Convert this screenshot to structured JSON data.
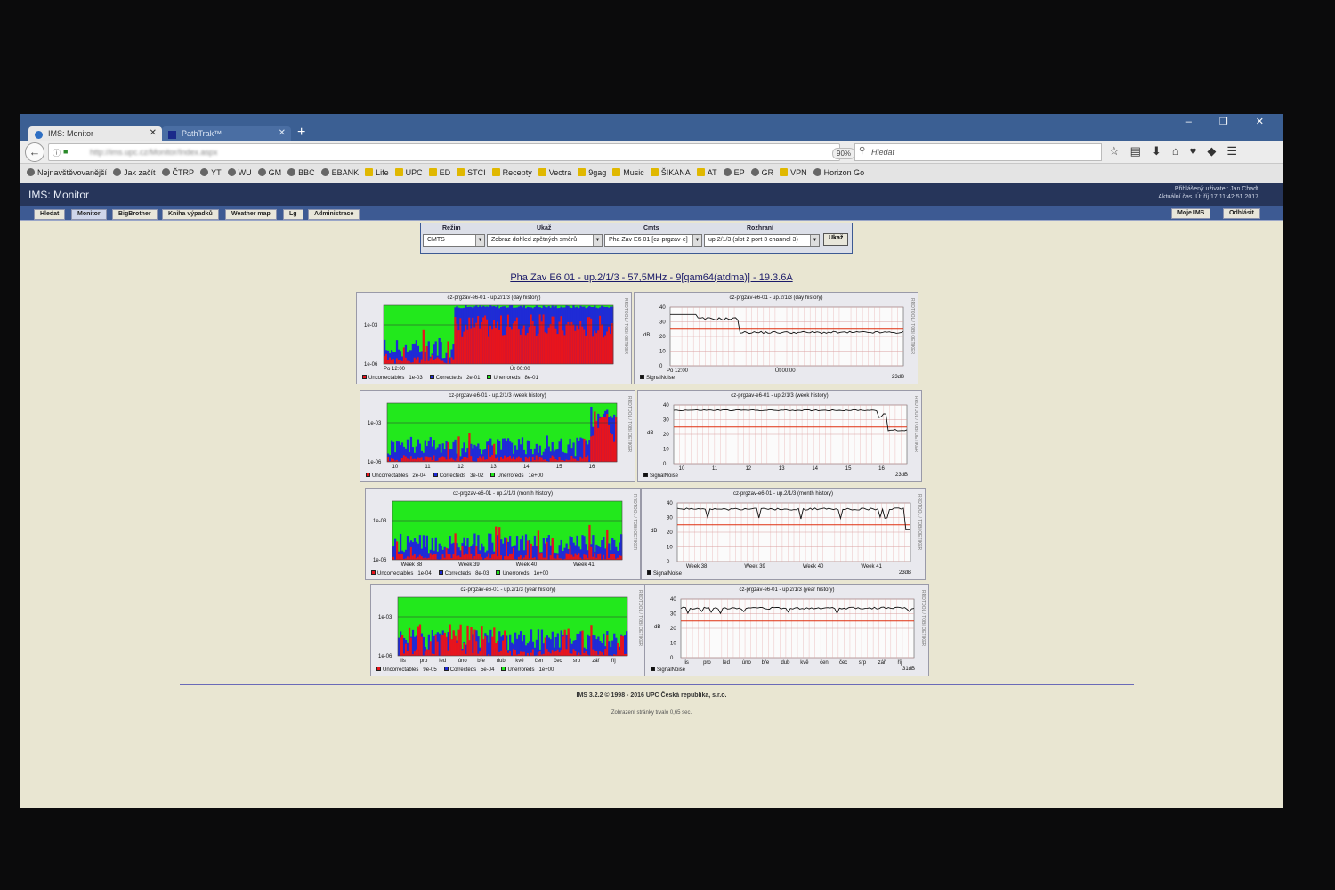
{
  "browser": {
    "tabs": [
      {
        "label": "IMS: Monitor",
        "active": true
      },
      {
        "label": "PathTrak™",
        "active": false
      }
    ],
    "url": "http://ims.upc.cz/Monitor/Index.aspx",
    "zoom": "90%",
    "search_placeholder": "Hledat",
    "bookmarks": [
      {
        "label": "Nejnavštěvovanější",
        "icon": "web"
      },
      {
        "label": "Jak začít",
        "icon": "web"
      },
      {
        "label": "ČTRP",
        "icon": "web"
      },
      {
        "label": "YT",
        "icon": "web"
      },
      {
        "label": "WU",
        "icon": "web"
      },
      {
        "label": "GM",
        "icon": "web"
      },
      {
        "label": "BBC",
        "icon": "web"
      },
      {
        "label": "EBANK",
        "icon": "web"
      },
      {
        "label": "Life",
        "icon": "folder"
      },
      {
        "label": "UPC",
        "icon": "folder"
      },
      {
        "label": "ED",
        "icon": "folder"
      },
      {
        "label": "STCI",
        "icon": "folder"
      },
      {
        "label": "Recepty",
        "icon": "folder"
      },
      {
        "label": "Vectra",
        "icon": "folder"
      },
      {
        "label": "9gag",
        "icon": "folder"
      },
      {
        "label": "Music",
        "icon": "folder"
      },
      {
        "label": "ŠIKANA",
        "icon": "folder"
      },
      {
        "label": "AT",
        "icon": "folder"
      },
      {
        "label": "EP",
        "icon": "web"
      },
      {
        "label": "GR",
        "icon": "web"
      },
      {
        "label": "VPN",
        "icon": "folder"
      },
      {
        "label": "Horizon Go",
        "icon": "web"
      }
    ]
  },
  "app": {
    "title": "IMS: Monitor",
    "user_line1": "Přihlášený uživatel: Jan Chadt",
    "user_line2": "Aktuální čas: Út říj 17 11:42:51 2017",
    "menu": [
      "Hledat",
      "Monitor",
      "BigBrother",
      "Kniha výpadků",
      "Weather map",
      "Lg",
      "Administrace"
    ],
    "right_buttons": [
      "Moje IMS",
      "Odhlásit"
    ]
  },
  "form": {
    "rezim_label": "Režim",
    "rezim_value": "CMTS",
    "ukaz_label": "Ukaž",
    "ukaz_value": "Zobraz dohled zpětných směrů",
    "cmts_label": "Cmts",
    "cmts_value": "Pha Zav E6 01 [cz-prgzav-e]",
    "rozhrani_label": "Rozhraní",
    "rozhrani_value": "up.2/1/3 (slot 2 port 3 channel 3)",
    "submit": "Ukaž"
  },
  "page_title": "Pha Zav E6 01 - up.2/1/3 - 57,5MHz - 9[qam64(atdma)] - 19.3.6A",
  "graphs": {
    "side_label": "RRDTOOL / TOBI OETIKER",
    "error": [
      {
        "title": "cz-prgzav-e6-01 - up.2/1/3 (day history)",
        "yticks": [
          "1e-03",
          "1e-06"
        ],
        "xticks": [
          "Po 12:00",
          "Út 00:00"
        ],
        "unc": "1e-03",
        "cor": "2e-01",
        "unerr": "8e-01"
      },
      {
        "title": "cz-prgzav-e6-01 - up.2/1/3 (week history)",
        "yticks": [
          "1e-03",
          "1e-06"
        ],
        "xticks": [
          "10",
          "11",
          "12",
          "13",
          "14",
          "15",
          "16"
        ],
        "unc": "2e-04",
        "cor": "3e-02",
        "unerr": "1e+00"
      },
      {
        "title": "cz-prgzav-e6-01 - up.2/1/3 (month history)",
        "yticks": [
          "1e-03",
          "1e-06"
        ],
        "xticks": [
          "Week 38",
          "Week 39",
          "Week 40",
          "Week 41"
        ],
        "unc": "1e-04",
        "cor": "8e-03",
        "unerr": "1e+00"
      },
      {
        "title": "cz-prgzav-e6-01 - up.2/1/3 (year history)",
        "yticks": [
          "1e-03",
          "1e-06"
        ],
        "xticks": [
          "lis",
          "pro",
          "led",
          "úno",
          "bře",
          "dub",
          "kvě",
          "čen",
          "čec",
          "srp",
          "zář",
          "říj"
        ],
        "unc": "9e-05",
        "cor": "5e-04",
        "unerr": "1e+00"
      }
    ],
    "snr": [
      {
        "title": "cz-prgzav-e6-01 - up.2/1/3 (day history)",
        "xticks": [
          "Po 12:00",
          "Út 00:00"
        ],
        "last": "23dB"
      },
      {
        "title": "cz-prgzav-e6-01 - up.2/1/3 (week history)",
        "xticks": [
          "10",
          "11",
          "12",
          "13",
          "14",
          "15",
          "16"
        ],
        "last": "23dB"
      },
      {
        "title": "cz-prgzav-e6-01 - up.2/1/3 (month history)",
        "xticks": [
          "Week 38",
          "Week 39",
          "Week 40",
          "Week 41"
        ],
        "last": "23dB"
      },
      {
        "title": "cz-prgzav-e6-01 - up.2/1/3 (year history)",
        "xticks": [
          "lis",
          "pro",
          "led",
          "úno",
          "bře",
          "dub",
          "kvě",
          "čen",
          "čec",
          "srp",
          "zář",
          "říj"
        ],
        "last": "31dB"
      }
    ],
    "snr_yticks": [
      "40",
      "30",
      "20",
      "10",
      "0"
    ],
    "snr_ylabel": "dB",
    "legend": {
      "unc": "Uncorrectables",
      "cor": "Correcteds",
      "unerr": "Unerroreds",
      "snr": "SignalNoise"
    },
    "colors": {
      "unc": "#e8141c",
      "cor": "#1f2bd6",
      "unerr": "#22e81c",
      "snr_line": "#111111",
      "threshold": "#e03010"
    }
  },
  "footer": {
    "copyright": "IMS 3.2.2 © 1998 - 2016 UPC Česká republika, s.r.o.",
    "timing": "Zobrazení stránky trvalo 0,65 sec."
  }
}
